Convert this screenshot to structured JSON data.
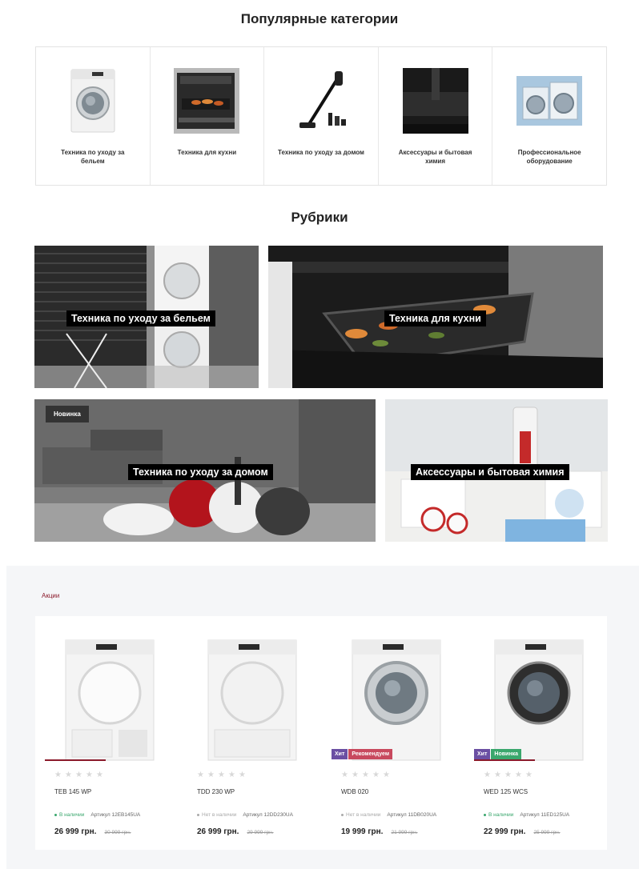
{
  "popular": {
    "title": "Популярные категории",
    "items": [
      {
        "label": "Техника по уходу за бельем",
        "icon": "washing-machine-icon"
      },
      {
        "label": "Техника для кухни",
        "icon": "oven-icon"
      },
      {
        "label": "Техника по уходу за домом",
        "icon": "vacuum-icon"
      },
      {
        "label": "Аксессуары и бытовая химия",
        "icon": "accessories-icon"
      },
      {
        "label": "Профессиональное оборудование",
        "icon": "pro-washers-icon"
      }
    ]
  },
  "rubrics": {
    "title": "Рубрики",
    "tiles": [
      {
        "caption": "Техника по уходу за бельем"
      },
      {
        "caption": "Техника для кухни"
      },
      {
        "caption": "Техника по уходу за домом",
        "badge": "Новинка"
      },
      {
        "caption": "Аксессуары и бытовая химия"
      }
    ]
  },
  "promo": {
    "label": "Акции",
    "products": [
      {
        "name": "TEB 145 WP",
        "stock": "В наличии",
        "in_stock": true,
        "sku": "Артикул 12EB145UA",
        "price": "26 999 грн.",
        "old_price": "30 999 грн.",
        "badges": []
      },
      {
        "name": "TDD 230 WP",
        "stock": "Нет в наличии",
        "in_stock": false,
        "sku": "Артикул 12DD230UA",
        "price": "26 999 грн.",
        "old_price": "29 999 грн.",
        "badges": []
      },
      {
        "name": "WDB 020",
        "stock": "Нет в наличии",
        "in_stock": false,
        "sku": "Артикул 11DB020UA",
        "price": "19 999 грн.",
        "old_price": "21 999 грн.",
        "badges": [
          {
            "text": "Хит",
            "color": "#6b4fa3"
          },
          {
            "text": "Рекомендуем",
            "color": "#c8495e"
          }
        ]
      },
      {
        "name": "WED 125 WCS",
        "stock": "В наличии",
        "in_stock": true,
        "sku": "Артикул 11ED125UA",
        "price": "22 999 грн.",
        "old_price": "25 999 грн.",
        "badges": [
          {
            "text": "Хит",
            "color": "#6b4fa3"
          },
          {
            "text": "Новинка",
            "color": "#3aa76d"
          }
        ]
      }
    ]
  },
  "colors": {
    "accent": "#8b1a2b",
    "in_stock": "#3aa76d",
    "out_stock": "#aaaaaa"
  }
}
